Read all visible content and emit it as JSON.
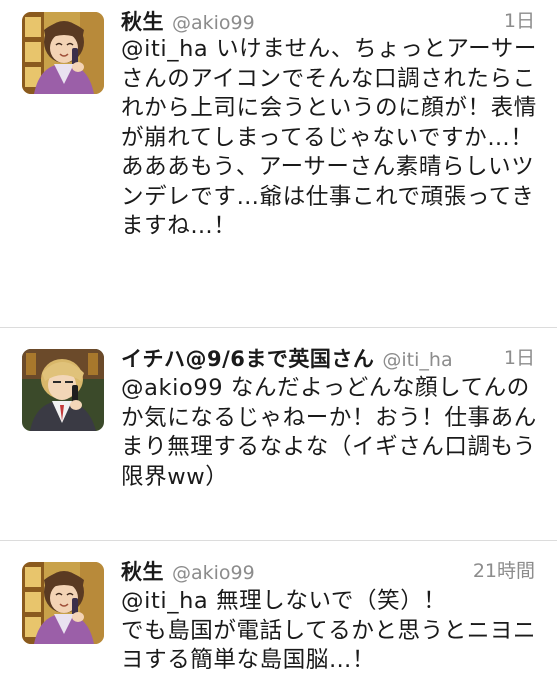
{
  "tweets": [
    {
      "name": "秋生",
      "handle": "@akio99",
      "time": "1日",
      "mention": "@iti_ha",
      "text": " いけません、ちょっとアーサーさんのアイコンでそんな口調されたらこれから上司に会うというのに顔が！表情が崩れてしまってるじゃないですか…！\nあああもう、アーサーさん素晴らしいツンデレです…爺は仕事これで頑張ってきますね…！"
    },
    {
      "name": "イチハ@9/6まで英国さん",
      "handle": "@iti_ha",
      "time": "1日",
      "mention": "@akio99",
      "text": " なんだよっどんな顔してんのか気になるじゃねーか！おう！仕事あんまり無理するなよな（イギさん口調もう限界ww）"
    },
    {
      "name": "秋生",
      "handle": "@akio99",
      "time": "21時間",
      "mention": "@iti_ha",
      "text": " 無理しないで（笑）！\nでも島国が電話してるかと思うとニヨニヨする簡単な島国脳…！"
    }
  ]
}
